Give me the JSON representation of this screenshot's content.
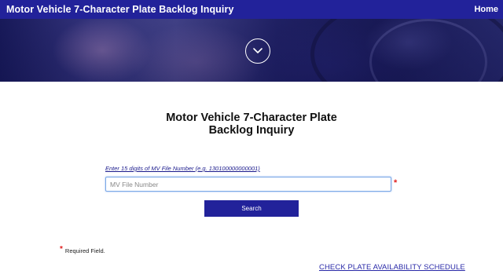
{
  "header": {
    "title": "Motor Vehicle 7-Character Plate Backlog Inquiry",
    "home_label": "Home"
  },
  "hero": {
    "scroll_icon": "chevron-down-icon"
  },
  "main": {
    "heading_line1": "Motor Vehicle 7-Character Plate",
    "heading_line2": "Backlog Inquiry",
    "field_hint": "Enter 15 digits of MV File Number (e.g. 130100000000001)",
    "mv_input": {
      "placeholder": "MV File Number",
      "value": ""
    },
    "required_marker": "*",
    "search_label": "Search",
    "required_note": "Required Field.",
    "schedule_link": "CHECK PLATE AVAILABILITY SCHEDULE"
  },
  "colors": {
    "brand": "#22229a",
    "required": "#e02020",
    "link": "#2a2aa8"
  }
}
